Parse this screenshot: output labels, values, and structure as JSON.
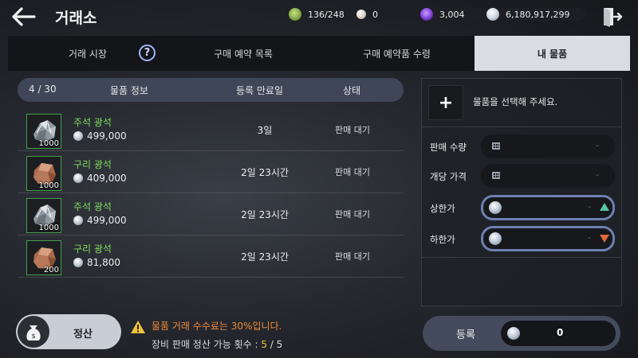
{
  "header": {
    "title": "거래소",
    "currencies": [
      {
        "name": "capacity",
        "icon": "bag-capacity-icon",
        "value": "136/248",
        "color": "#7ea34a"
      },
      {
        "name": "pearl",
        "icon": "pearl-icon",
        "value": "0",
        "color": "#d8d0c8"
      },
      {
        "name": "dark-orb",
        "icon": "dark-orb-icon",
        "value": "3,004",
        "color": "#7b3ed6"
      },
      {
        "name": "silver",
        "icon": "silver-coin-icon",
        "value": "6,180,917,299",
        "color": "#c8d2de"
      }
    ]
  },
  "tabs": [
    {
      "label": "거래 시장",
      "active": false
    },
    {
      "label": "구매 예약 목록",
      "active": false
    },
    {
      "label": "구매 예약품 수령",
      "active": false
    },
    {
      "label": "내 물품",
      "active": true
    }
  ],
  "list": {
    "count": "4 / 30",
    "columns": {
      "info": "물품 정보",
      "expiry": "등록 만료일",
      "status": "상태"
    },
    "items": [
      {
        "name": "주석 광석",
        "price": "499,000",
        "qty": "1000",
        "expiry": "3일",
        "status": "판매 대기",
        "icon": "tin-ore-icon"
      },
      {
        "name": "구리 광석",
        "price": "409,000",
        "qty": "1000",
        "expiry": "2일 23시간",
        "status": "판매 대기",
        "icon": "copper-ore-icon"
      },
      {
        "name": "주석 광석",
        "price": "499,000",
        "qty": "1000",
        "expiry": "2일 23시간",
        "status": "판매 대기",
        "icon": "tin-ore-icon"
      },
      {
        "name": "구리 광석",
        "price": "81,800",
        "qty": "200",
        "expiry": "2일 23시간",
        "status": "판매 대기",
        "icon": "copper-ore-icon"
      }
    ]
  },
  "register_panel": {
    "select_prompt": "물품을 선택해 주세요.",
    "sell_qty_label": "판매 수량",
    "unit_price_label": "개당 가격",
    "upper_limit_label": "상한가",
    "lower_limit_label": "하한가",
    "empty_value": "-"
  },
  "footer": {
    "settle_label": "정산",
    "fee_notice": "물품 거래 수수료는 30%입니다.",
    "settle_count_label": "장비 판매 정산 가능 횟수 : ",
    "settle_count_current": "5",
    "settle_count_sep": " / ",
    "settle_count_max": "5",
    "register_label": "등록",
    "register_total": "0"
  }
}
